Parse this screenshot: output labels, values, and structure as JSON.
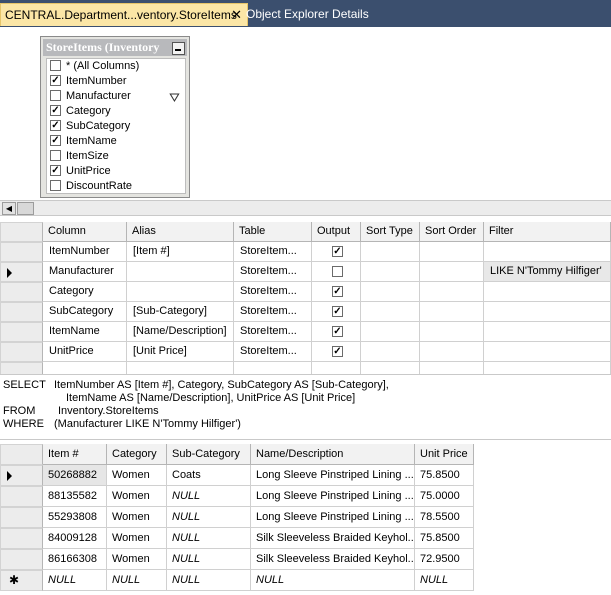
{
  "tabs": {
    "active_title": "CENTRAL.Department...ventory.StoreItems",
    "close_glyph": "✕",
    "inactive_title": "Object Explorer Details"
  },
  "diagram": {
    "table_title": "StoreItems (Inventory",
    "columns": [
      {
        "name": "* (All Columns)",
        "checked": false
      },
      {
        "name": "ItemNumber",
        "checked": true
      },
      {
        "name": "Manufacturer",
        "checked": false,
        "filter_icon": "funnel-icon"
      },
      {
        "name": "Category",
        "checked": true
      },
      {
        "name": "SubCategory",
        "checked": true
      },
      {
        "name": "ItemName",
        "checked": true
      },
      {
        "name": "ItemSize",
        "checked": false
      },
      {
        "name": "UnitPrice",
        "checked": true
      },
      {
        "name": "DiscountRate",
        "checked": false
      }
    ]
  },
  "criteria": {
    "headers": [
      "Column",
      "Alias",
      "Table",
      "Output",
      "Sort Type",
      "Sort Order",
      "Filter"
    ],
    "rows": [
      {
        "column": "ItemNumber",
        "alias": "[Item #]",
        "table": "StoreItem...",
        "output": true,
        "filter": ""
      },
      {
        "column": "Manufacturer",
        "alias": "",
        "table": "StoreItem...",
        "output": false,
        "filter": "LIKE N'Tommy Hilfiger'",
        "current": true
      },
      {
        "column": "Category",
        "alias": "",
        "table": "StoreItem...",
        "output": true,
        "filter": ""
      },
      {
        "column": "SubCategory",
        "alias": "[Sub-Category]",
        "table": "StoreItem...",
        "output": true,
        "filter": ""
      },
      {
        "column": "ItemName",
        "alias": "[Name/Description]",
        "table": "StoreItem...",
        "output": true,
        "filter": ""
      },
      {
        "column": "UnitPrice",
        "alias": "[Unit Price]",
        "table": "StoreItem...",
        "output": true,
        "filter": ""
      }
    ]
  },
  "sql": {
    "select_kw": "SELECT",
    "select_line1": "ItemNumber AS [Item #], Category, SubCategory AS [Sub-Category],",
    "select_line2": "ItemName AS [Name/Description], UnitPrice AS [Unit Price]",
    "from_kw": "FROM",
    "from_text": "Inventory.StoreItems",
    "where_kw": "WHERE",
    "where_text": "(Manufacturer LIKE N'Tommy Hilfiger')"
  },
  "results": {
    "headers": [
      "Item #",
      "Category",
      "Sub-Category",
      "Name/Description",
      "Unit Price"
    ],
    "rows": [
      [
        "50268882",
        "Women",
        "Coats",
        "Long Sleeve Pinstriped Lining ...",
        "75.8500"
      ],
      [
        "88135582",
        "Women",
        "NULL",
        "Long Sleeve Pinstriped Lining ...",
        "75.0000"
      ],
      [
        "55293808",
        "Women",
        "NULL",
        "Long Sleeve Pinstriped Lining ...",
        "78.5500"
      ],
      [
        "84009128",
        "Women",
        "NULL",
        "Silk Sleeveless Braided Keyhol...",
        "75.8500"
      ],
      [
        "86166308",
        "Women",
        "NULL",
        "Silk Sleeveless Braided Keyhol...",
        "72.9500"
      ]
    ],
    "new_row": [
      "NULL",
      "NULL",
      "NULL",
      "NULL",
      "NULL"
    ],
    "new_row_glyph": "✱"
  }
}
